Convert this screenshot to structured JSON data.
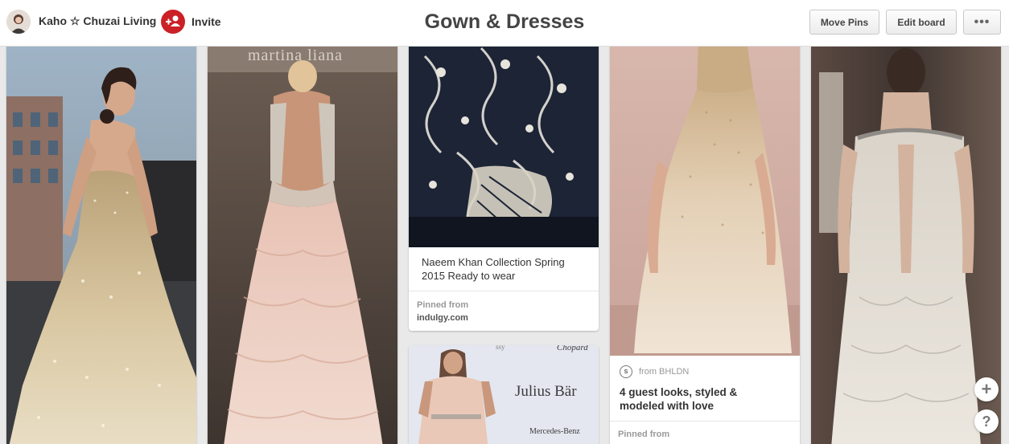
{
  "header": {
    "owner_name": "Kaho ☆ Chuzai Living",
    "invite_label": "Invite",
    "board_title": "Gown & Dresses",
    "move_pins_label": "Move Pins",
    "edit_board_label": "Edit board",
    "more_label": "•••"
  },
  "pins": [
    {
      "image": "sequin strapless gown on city street"
    },
    {
      "image": "open-back blush ruffle gown",
      "photo_text": "martina liana"
    },
    {
      "image": "navy and white embroidered gown detail",
      "description": "Naeem Khan Collection Spring 2015 Ready to wear",
      "pinned_from_label": "Pinned from",
      "pinned_from_source": "indulgy.com"
    },
    {
      "image": "blush gown at Julius Bär event",
      "photo_texts": [
        "Julius Bär",
        "Mercedes-Benz",
        "Chopard",
        "ssy"
      ]
    },
    {
      "image": "sparkling champagne tulle gown",
      "from_badge": "S",
      "from_text": "from BHLDN",
      "description": "4 guest looks, styled & modeled with love",
      "pinned_from_label": "Pinned from"
    },
    {
      "image": "beaded keyhole-back gown on runway"
    }
  ],
  "floating": {
    "add_label": "+",
    "help_label": "?"
  },
  "colors": {
    "accent_red": "#cb2027",
    "background": "#e9e9e9",
    "header": "#ffffff"
  }
}
